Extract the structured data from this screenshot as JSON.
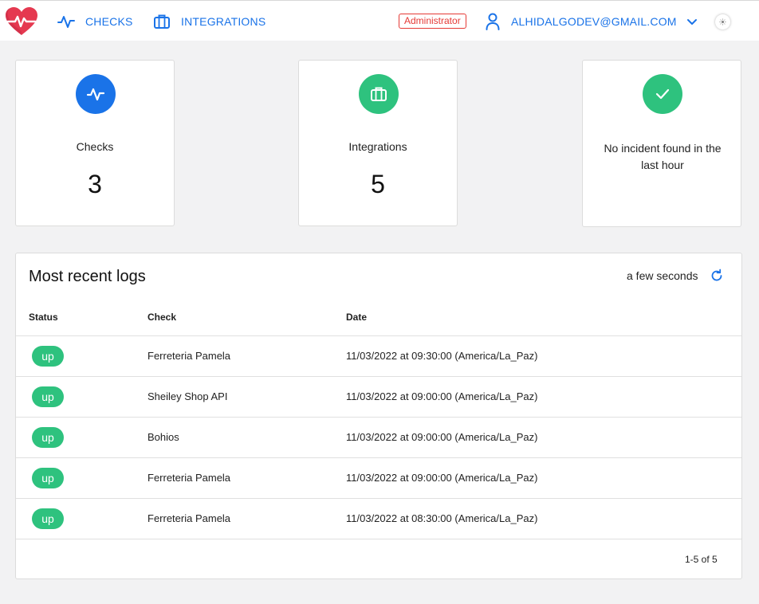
{
  "header": {
    "nav": [
      {
        "label": "CHECKS",
        "icon": "activity-icon"
      },
      {
        "label": "INTEGRATIONS",
        "icon": "briefcase-icon"
      }
    ],
    "role": "Administrator",
    "user_email": "ALHIDALGODEV@GMAIL.COM",
    "colors": {
      "accent": "#1a73e8",
      "logo": "#e53950",
      "role": "#e53935"
    }
  },
  "stats": {
    "checks": {
      "label": "Checks",
      "value": "3",
      "color": "#1a73e8"
    },
    "integrations": {
      "label": "Integrations",
      "value": "5",
      "color": "#2ec27e"
    },
    "incidents": {
      "message": "No incident found in the last hour",
      "color": "#2ec27e"
    }
  },
  "logs": {
    "title": "Most recent logs",
    "updated": "a few seconds",
    "columns": [
      "Status",
      "Check",
      "Date"
    ],
    "rows": [
      {
        "status": "up",
        "check": "Ferreteria Pamela",
        "date": "11/03/2022 at 09:30:00 (America/La_Paz)"
      },
      {
        "status": "up",
        "check": "Sheiley Shop API",
        "date": "11/03/2022 at 09:00:00 (America/La_Paz)"
      },
      {
        "status": "up",
        "check": "Bohios",
        "date": "11/03/2022 at 09:00:00 (America/La_Paz)"
      },
      {
        "status": "up",
        "check": "Ferreteria Pamela",
        "date": "11/03/2022 at 09:00:00 (America/La_Paz)"
      },
      {
        "status": "up",
        "check": "Ferreteria Pamela",
        "date": "11/03/2022 at 08:30:00 (America/La_Paz)"
      }
    ],
    "pagination": "1-5 of 5"
  }
}
